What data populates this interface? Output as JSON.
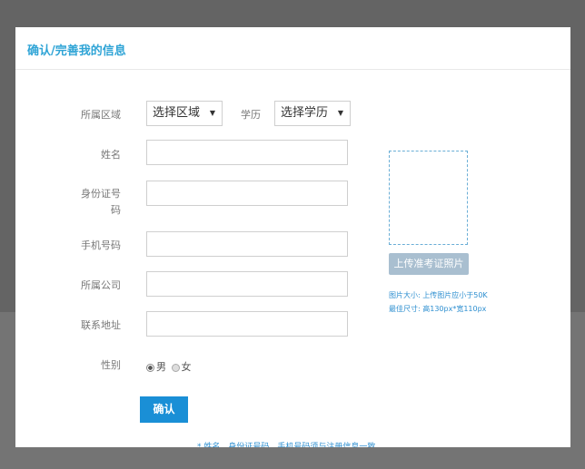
{
  "modal": {
    "title": "确认/完善我的信息"
  },
  "form": {
    "region_label": "所属区域",
    "region_select": "选择区域",
    "education_label": "学历",
    "education_select": "选择学历",
    "name_label": "姓名",
    "id_label_line1": "身份证号",
    "id_label_line2": "码",
    "phone_label": "手机号码",
    "company_label": "所属公司",
    "address_label": "联系地址",
    "gender_label": "性别",
    "gender_male": "男",
    "gender_female": "女",
    "gender_selected": "男",
    "confirm_button": "确认",
    "footnote": "* 姓名、身份证号码、手机号码须与注册信息一致"
  },
  "photo": {
    "upload_button": "上传准考证照片",
    "note_size": "图片大小: 上传图片应小于50K",
    "note_dimensions": "最佳尺寸: 高130px*宽110px"
  },
  "colors": {
    "accent": "#2fa4d6",
    "button": "#1a8fd6",
    "upload_button": "#a9bfd0",
    "overlay": "#646464"
  }
}
